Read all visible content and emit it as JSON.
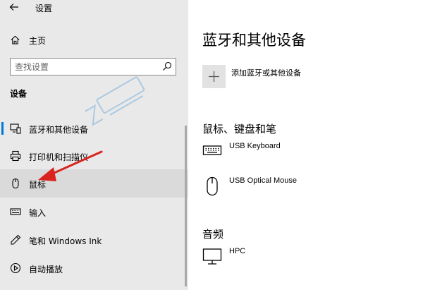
{
  "window": {
    "title": "设置"
  },
  "sidebar": {
    "home_label": "主页",
    "search": {
      "placeholder": "查找设置"
    },
    "section_heading": "设备",
    "items": [
      {
        "label": "蓝牙和其他设备",
        "icon": "bluetooth-devices-icon",
        "selected": true
      },
      {
        "label": "打印机和扫描仪",
        "icon": "printer-icon"
      },
      {
        "label": "鼠标",
        "icon": "mouse-icon",
        "hovered": true
      },
      {
        "label": "输入",
        "icon": "keyboard-icon"
      },
      {
        "label": "笔和 Windows Ink",
        "icon": "pen-icon"
      },
      {
        "label": "自动播放",
        "icon": "autoplay-icon"
      }
    ]
  },
  "main": {
    "title": "蓝牙和其他设备",
    "add_device_label": "添加蓝牙或其他设备",
    "sections": [
      {
        "title": "鼠标、键盘和笔",
        "devices": [
          {
            "name": "USB Keyboard",
            "icon": "keyboard-icon"
          },
          {
            "name": "USB Optical Mouse",
            "icon": "mouse-icon"
          }
        ]
      },
      {
        "title": "音频",
        "devices": [
          {
            "name": "HPC",
            "icon": "monitor-icon"
          }
        ]
      }
    ]
  },
  "colors": {
    "sidebar_bg": "#e9e9e9",
    "hover_bg": "#dadada",
    "accent": "#0078d7",
    "arrow": "#d9241e",
    "watermark": "#3a8fd0"
  }
}
